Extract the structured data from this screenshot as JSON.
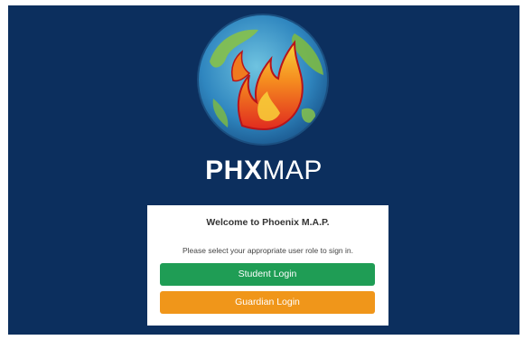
{
  "brand": {
    "part1": "PHX",
    "part2": "MAP",
    "logo_icon": "globe-flame-icon"
  },
  "card": {
    "title": "Welcome to Phoenix M.A.P.",
    "instruction": "Please select your appropriate user role to sign in.",
    "student_label": "Student Login",
    "guardian_label": "Guardian Login"
  },
  "colors": {
    "background": "#0c2f5e",
    "student": "#1f9d55",
    "guardian": "#f0961a"
  }
}
